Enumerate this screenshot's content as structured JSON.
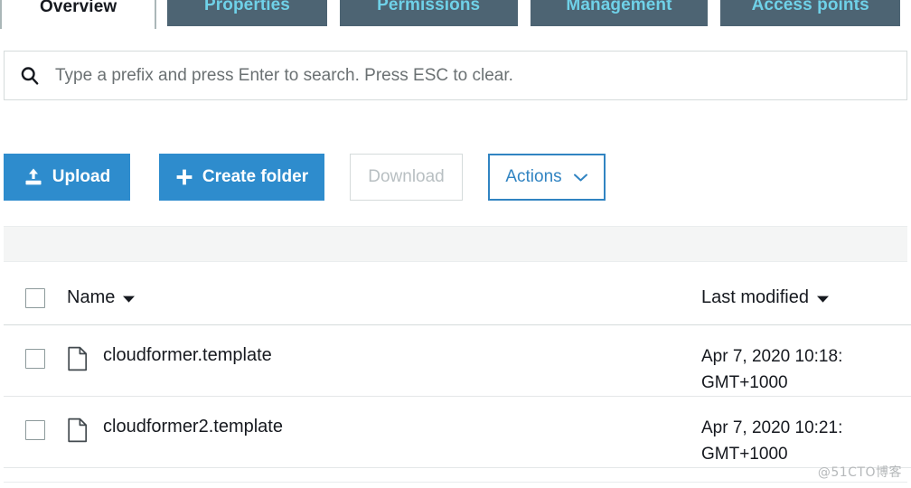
{
  "tabs": [
    {
      "label": "Overview",
      "active": true
    },
    {
      "label": "Properties",
      "active": false
    },
    {
      "label": "Permissions",
      "active": false
    },
    {
      "label": "Management",
      "active": false
    },
    {
      "label": "Access points",
      "active": false
    }
  ],
  "search": {
    "placeholder": "Type a prefix and press Enter to search. Press ESC to clear.",
    "value": "",
    "icon": "search-icon"
  },
  "toolbar": {
    "upload_label": "Upload",
    "upload_icon": "upload-icon",
    "create_folder_label": "Create folder",
    "create_folder_icon": "plus-icon",
    "download_label": "Download",
    "download_disabled": true,
    "actions_label": "Actions",
    "actions_icon": "chevron-down-icon"
  },
  "table": {
    "headers": {
      "name": "Name",
      "last_modified": "Last modified",
      "sort_caret_icon": "caret-down-icon",
      "select_all_checkbox": "checkbox"
    },
    "rows": [
      {
        "name": "cloudformer.template",
        "icon": "file-icon",
        "last_modified_line1": "Apr 7, 2020 10:18:",
        "last_modified_line2": "GMT+1000"
      },
      {
        "name": "cloudformer2.template",
        "icon": "file-icon",
        "last_modified_line1": "Apr 7, 2020 10:21:",
        "last_modified_line2": "GMT+1000"
      }
    ]
  },
  "watermark": {
    "text": "@51CTO博客"
  },
  "colors": {
    "primary_blue": "#2e8ccd",
    "outline_blue": "#3184c2",
    "tab_inactive_bg": "#4d6473",
    "tab_inactive_text": "#6fd1e8",
    "disabled_text": "#b8bfc2",
    "band_grey": "#f4f5f5"
  }
}
